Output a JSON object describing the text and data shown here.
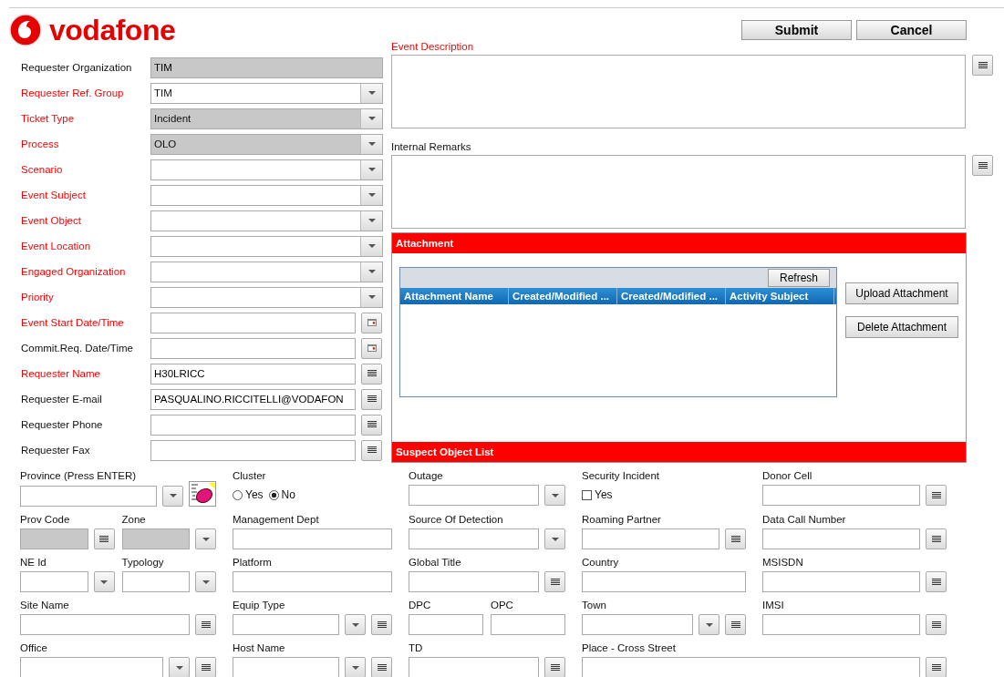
{
  "logo": {
    "text": "vodafone"
  },
  "actions": [
    {
      "label": "Submit"
    },
    {
      "label": "Cancel"
    }
  ],
  "main_form": [
    {
      "label": "Requester Organization",
      "required": false,
      "kind": "text",
      "value": "TIM",
      "disabled": true
    },
    {
      "label": "Requester Ref. Group",
      "required": true,
      "kind": "select",
      "value": "TIM",
      "disabled": false
    },
    {
      "label": "Ticket Type",
      "required": true,
      "kind": "select",
      "value": "Incident",
      "disabled": true
    },
    {
      "label": "Process",
      "required": true,
      "kind": "select",
      "value": "OLO",
      "disabled": true
    },
    {
      "label": "Scenario",
      "required": true,
      "kind": "select",
      "disabled": false
    },
    {
      "label": "Event Subject",
      "required": true,
      "kind": "select",
      "disabled": false
    },
    {
      "label": "Event Object",
      "required": true,
      "kind": "select",
      "disabled": false
    },
    {
      "label": "Event Location",
      "required": true,
      "kind": "select",
      "disabled": false
    },
    {
      "label": "Engaged Organization",
      "required": true,
      "kind": "select",
      "disabled": false
    },
    {
      "label": "Priority",
      "required": true,
      "kind": "select",
      "disabled": false
    },
    {
      "label": "Event Start Date/Time",
      "required": true,
      "kind": "date",
      "disabled": false
    },
    {
      "label": "Commit.Req. Date/Time",
      "required": false,
      "kind": "date",
      "disabled": false
    },
    {
      "label": "Requester Name",
      "required": true,
      "kind": "lookup",
      "value": "H30LRICC",
      "disabled": false
    },
    {
      "label": "Requester E-mail",
      "required": false,
      "kind": "lookup",
      "value": "PASQUALINO.RICCITELLI@VODAFON",
      "disabled": false
    },
    {
      "label": "Requester Phone",
      "required": false,
      "kind": "lookup",
      "disabled": false
    },
    {
      "label": "Requester Fax",
      "required": false,
      "kind": "lookup",
      "disabled": false
    }
  ],
  "notes": [
    {
      "label": "Event Description",
      "required": true
    },
    {
      "label": "Internal Remarks",
      "required": false
    }
  ],
  "attachment": {
    "title": "Attachment",
    "refresh": "Refresh",
    "columns": [
      "Attachment Name",
      "Created/Modified ...",
      "Created/Modified ...",
      "Activity Subject"
    ],
    "buttons": [
      "Upload Attachment",
      "Delete Attachment"
    ]
  },
  "suspect_object_list": {
    "title": "Suspect Object List"
  },
  "detail_rows": [
    [
      {
        "fields": [
          {
            "label": "Province (Press ENTER)",
            "kind": "select_map",
            "disabled": false
          }
        ]
      },
      {
        "fields": [
          {
            "label": "Cluster",
            "kind": "radio",
            "options": [
              {
                "label": "Yes",
                "selected": false
              },
              {
                "label": "No",
                "selected": true
              }
            ]
          }
        ]
      },
      {
        "fields": [
          {
            "label": "Outage",
            "kind": "select",
            "disabled": false
          }
        ]
      },
      {
        "fields": [
          {
            "label": "Security Incident",
            "kind": "checkbox",
            "option": "Yes",
            "checked": false
          }
        ]
      },
      {
        "fields": [
          {
            "label": "Donor Cell",
            "kind": "lookup",
            "disabled": false
          }
        ]
      }
    ],
    [
      {
        "fields": [
          {
            "label": "Prov Code",
            "kind": "lookup",
            "disabled": true
          },
          {
            "label": "Zone",
            "kind": "select",
            "disabled": true
          }
        ]
      },
      {
        "fields": [
          {
            "label": "Management Dept",
            "kind": "text",
            "disabled": false
          }
        ]
      },
      {
        "fields": [
          {
            "label": "Source Of Detection",
            "kind": "select",
            "disabled": false
          }
        ]
      },
      {
        "fields": [
          {
            "label": "Roaming Partner",
            "kind": "lookup",
            "disabled": false
          }
        ]
      },
      {
        "fields": [
          {
            "label": "Data Call Number",
            "kind": "lookup",
            "disabled": false
          }
        ]
      }
    ],
    [
      {
        "fields": [
          {
            "label": "NE Id",
            "kind": "select",
            "disabled": false
          },
          {
            "label": "Typology",
            "kind": "select",
            "disabled": false
          }
        ]
      },
      {
        "fields": [
          {
            "label": "Platform",
            "kind": "text",
            "disabled": false
          }
        ]
      },
      {
        "fields": [
          {
            "label": "Global Title",
            "kind": "lookup",
            "disabled": false
          }
        ]
      },
      {
        "fields": [
          {
            "label": "Country",
            "kind": "text",
            "disabled": false
          }
        ]
      },
      {
        "fields": [
          {
            "label": "MSISDN",
            "kind": "lookup",
            "disabled": false
          }
        ]
      }
    ],
    [
      {
        "fields": [
          {
            "label": "Site Name",
            "kind": "lookup",
            "disabled": false
          }
        ]
      },
      {
        "fields": [
          {
            "label": "Equip Type",
            "kind": "select_lookup",
            "disabled": false
          }
        ]
      },
      {
        "fields": [
          {
            "label": "DPC",
            "kind": "text",
            "disabled": false
          },
          {
            "label": "OPC",
            "kind": "text",
            "disabled": false
          }
        ]
      },
      {
        "fields": [
          {
            "label": "Town",
            "kind": "select_lookup",
            "disabled": false
          }
        ]
      },
      {
        "fields": [
          {
            "label": "IMSI",
            "kind": "lookup",
            "disabled": false
          }
        ]
      }
    ],
    [
      {
        "fields": [
          {
            "label": "Office",
            "kind": "select_lookup",
            "disabled": false
          }
        ]
      },
      {
        "fields": [
          {
            "label": "Host Name",
            "kind": "select_lookup",
            "disabled": false
          }
        ]
      },
      {
        "fields": [
          {
            "label": "TD",
            "kind": "lookup",
            "disabled": false
          }
        ]
      },
      {
        "fields": [
          {
            "label": "Place - Cross Street",
            "kind": "lookup",
            "disabled": false
          }
        ],
        "wide": true
      }
    ]
  ]
}
